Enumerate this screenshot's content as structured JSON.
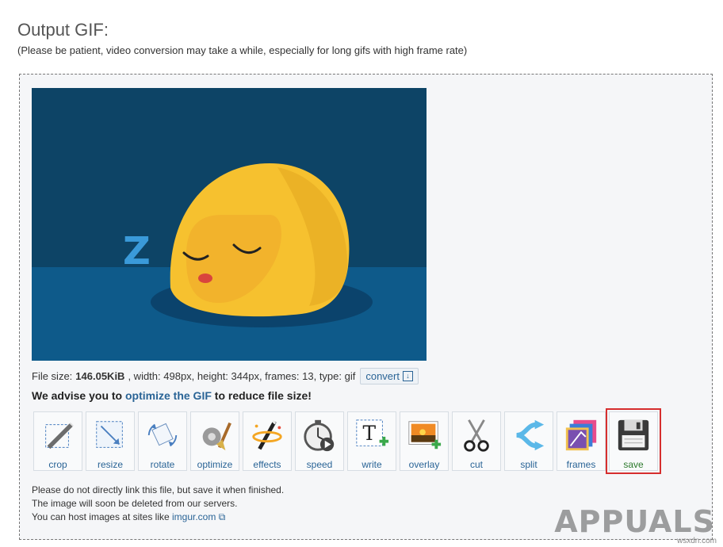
{
  "header": {
    "title": "Output GIF:",
    "note": "(Please be patient, video conversion may take a while, especially for long gifs with high frame rate)"
  },
  "file_info": {
    "size_label": "File size: ",
    "size_value": "146.05KiB",
    "details": ", width: 498px, height: 344px, frames: 13, type: gif",
    "convert_label": "convert"
  },
  "advice": {
    "prefix": "We advise you to ",
    "link": "optimize the GIF",
    "suffix": " to reduce file size!"
  },
  "tools": [
    {
      "label": "crop",
      "icon": "crop-icon"
    },
    {
      "label": "resize",
      "icon": "resize-icon"
    },
    {
      "label": "rotate",
      "icon": "rotate-icon"
    },
    {
      "label": "optimize",
      "icon": "optimize-icon"
    },
    {
      "label": "effects",
      "icon": "effects-icon"
    },
    {
      "label": "speed",
      "icon": "speed-icon"
    },
    {
      "label": "write",
      "icon": "write-icon"
    },
    {
      "label": "overlay",
      "icon": "overlay-icon"
    },
    {
      "label": "cut",
      "icon": "scissors-icon"
    },
    {
      "label": "split",
      "icon": "split-icon"
    },
    {
      "label": "frames",
      "icon": "frames-icon"
    },
    {
      "label": "save",
      "icon": "floppy-disk-icon",
      "highlighted": true
    }
  ],
  "footer": {
    "line1": "Please do not directly link this file, but save it when finished.",
    "line2": "The image will soon be deleted from our servers.",
    "line3_prefix": "You can host images at sites like ",
    "line3_link": "imgur.com"
  },
  "watermark": {
    "brand": "APPUALS",
    "site": "wsxdn.com"
  },
  "colors": {
    "accent": "#2a6496",
    "highlight": "#d62e2e",
    "preview_bg": "#0d4466",
    "emoji": "#f6c12f"
  }
}
